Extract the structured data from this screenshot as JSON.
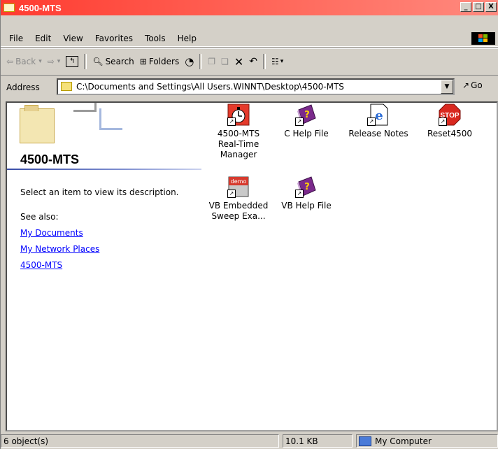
{
  "window": {
    "title": "4500-MTS"
  },
  "title_controls": {
    "minimize": "_",
    "maximize": "□",
    "close": "X"
  },
  "menu": [
    "File",
    "Edit",
    "View",
    "Favorites",
    "Tools",
    "Help"
  ],
  "toolbar": {
    "back": "Back",
    "search": "Search",
    "folders": "Folders"
  },
  "address": {
    "label": "Address",
    "value": "C:\\Documents and Settings\\All Users.WINNT\\Desktop\\4500-MTS",
    "go": "Go"
  },
  "left_pane": {
    "title": "4500-MTS",
    "description": "Select an item to view its description.",
    "see_also": "See also:",
    "links": [
      "My Documents",
      "My Network Places",
      "4500-MTS"
    ]
  },
  "items": [
    {
      "label_lines": [
        "4500-MTS",
        "Real-Time",
        "Manager"
      ],
      "icon": "stopwatch-icon"
    },
    {
      "label_lines": [
        "C Help File"
      ],
      "icon": "help-book-icon"
    },
    {
      "label_lines": [
        "Release Notes"
      ],
      "icon": "ie-document-icon"
    },
    {
      "label_lines": [
        "Reset4500"
      ],
      "icon": "stop-sign-icon"
    },
    {
      "label_lines": [
        "VB Embedded",
        "Sweep Exa..."
      ],
      "icon": "demo-icon"
    },
    {
      "label_lines": [
        "VB Help File"
      ],
      "icon": "help-book-icon"
    }
  ],
  "status": {
    "objects": "6 object(s)",
    "size": "10.1 KB",
    "location": "My Computer"
  },
  "colors": {
    "title_bar": "#ff3b30",
    "link": "#0000ff",
    "chrome": "#d4d0c8"
  }
}
